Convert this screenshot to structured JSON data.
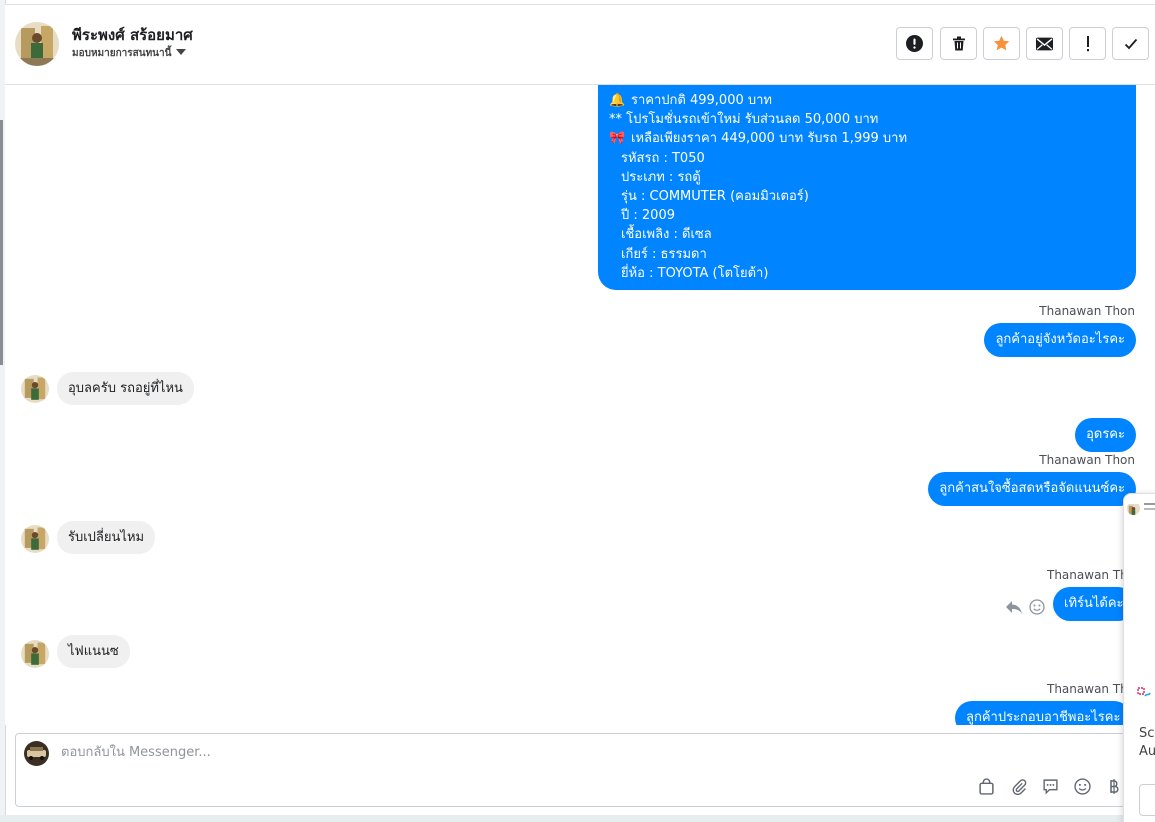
{
  "header": {
    "contact_name": "พีระพงศ์ สร้อยมาศ",
    "assign_label": "มอบหมายการสนทนานี้",
    "actions": [
      {
        "icon": "alert-circle-icon",
        "name": "spam-button"
      },
      {
        "icon": "trash-icon",
        "name": "delete-button"
      },
      {
        "icon": "star-icon",
        "name": "star-button"
      },
      {
        "icon": "mail-icon",
        "name": "mark-unread-button"
      },
      {
        "icon": "exclamation-icon",
        "name": "follow-up-button"
      },
      {
        "icon": "check-icon",
        "name": "mark-done-button"
      }
    ],
    "star_color": "#f7923a"
  },
  "thread": {
    "listing": {
      "lines": [
        {
          "emoji": "🔔",
          "text": "ราคาปกติ 499,000 บาท"
        },
        {
          "emoji": "",
          "text": "** โปรโมชั่นรถเข้าใหม่ รับส่วนลด 50,000 บาท"
        },
        {
          "emoji": "🎀",
          "text": "เหลือเพียงราคา 449,000 บาท รับรถ 1,999 บาท"
        },
        {
          "emoji": "",
          "text": "รหัสรถ : T050"
        },
        {
          "emoji": "",
          "text": "ประเภท : รถตู้"
        },
        {
          "emoji": "",
          "text": "รุ่น : COMMUTER (คอมมิวเตอร์)"
        },
        {
          "emoji": "",
          "text": "ปี : 2009"
        },
        {
          "emoji": "",
          "text": "เชื้อเพลิง : ดีเซล"
        },
        {
          "emoji": "",
          "text": "เกียร์ : ธรรมดา"
        },
        {
          "emoji": "",
          "text": "ยี่ห้อ : TOYOTA (โตโยต้า)"
        }
      ]
    },
    "messages": [
      {
        "sender": "Thanawan Thon",
        "text": "ลูกค้าอยู่จังหวัดอะไรคะ"
      },
      {
        "text": "อุบลครับ รถอยู่ที่ไหน"
      },
      {
        "text": "อุดรคะ"
      },
      {
        "sender": "Thanawan Thon",
        "text": "ลูกค้าสนใจซื้อสดหรือจัดแนนซ์คะ"
      },
      {
        "text": "รับเปลี่ยนไหม"
      },
      {
        "sender": "Thanawan Tho",
        "text": "เทิร์นได้คะ"
      },
      {
        "text": "ไฟแนนซ"
      },
      {
        "sender": "Thanawan Tho",
        "text": "ลูกค้าประกอบอาชีพอะไรคะ"
      }
    ],
    "outgoing_color": "#0084ff",
    "incoming_color": "#f0f0f0"
  },
  "composer": {
    "placeholder": "ตอบกลับใน Messenger...",
    "tools": [
      "bag-icon",
      "paperclip-icon",
      "saved-reply-icon",
      "emoji-icon",
      "baht-icon"
    ]
  },
  "floating_panel": {
    "line1": "Scr",
    "line2": "Au"
  }
}
